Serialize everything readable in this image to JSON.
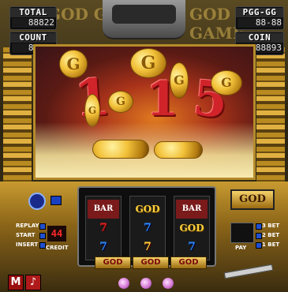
{
  "hud": {
    "total_label": "TOTAL",
    "total_value": "88822",
    "count_label": "COUNT",
    "count_value": "88886",
    "pgg_label": "PGG-GG",
    "pgg_value": "88-88",
    "coin_label": "COIN",
    "coin_value": "88893"
  },
  "screen": {
    "digits": [
      "1",
      "1",
      "5"
    ],
    "coin_letter": "G",
    "backdrop_text_left": "GOD GAME",
    "backdrop_text_right": "GOD GAME"
  },
  "panel": {
    "replay_label": "REPLAY",
    "start_label": "START",
    "insert_label": "INSERT",
    "credit_label": "CREDIT",
    "credit_value": "44",
    "bet3_label": "3 BET",
    "bet2_label": "2 BET",
    "bet1_label": "1 BET",
    "pay_label": "PAY",
    "side_plate": "GOD"
  },
  "reels": {
    "left": [
      "BAR",
      "7",
      "7"
    ],
    "center": [
      "GOD",
      "7",
      "7"
    ],
    "right": [
      "BAR",
      "GOD",
      "7"
    ]
  },
  "plates": [
    "GOD",
    "GOD",
    "GOD"
  ],
  "buttons": {
    "menu": "M",
    "sound": "♪"
  },
  "colors": {
    "led_red": "#ff2a2a",
    "gold": "#f3c23a",
    "seven_red": "#e22222",
    "seven_blue": "#2a8aff"
  }
}
